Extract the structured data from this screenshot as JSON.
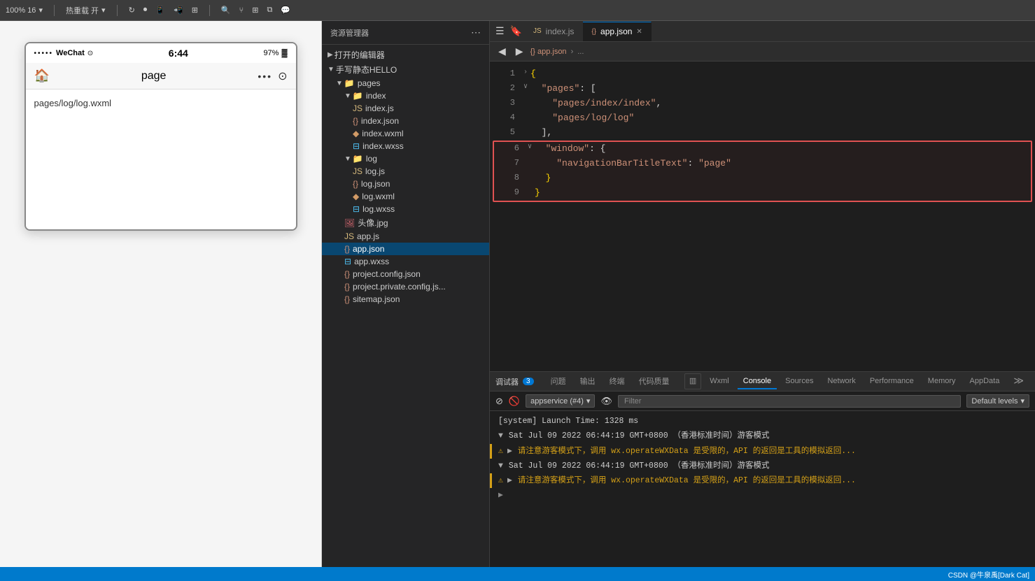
{
  "toolbar": {
    "zoom": "100% 16",
    "hotreload": "热重载 开",
    "icons": [
      "refresh",
      "record",
      "phone",
      "tablet",
      "split",
      "search",
      "branch",
      "grid",
      "copy",
      "wechat"
    ],
    "tabs": [
      {
        "label": "index.js",
        "icon": "js"
      },
      {
        "label": "app.json",
        "icon": "json",
        "active": true,
        "closeable": true
      }
    ]
  },
  "file_explorer": {
    "title": "资源管理器",
    "sections": [
      {
        "label": "打开的编辑器",
        "expanded": false
      },
      {
        "label": "手写静态HELLO",
        "expanded": true
      }
    ],
    "tree": [
      {
        "name": "pages",
        "type": "folder",
        "indent": 2,
        "expanded": true
      },
      {
        "name": "index",
        "type": "folder",
        "indent": 3,
        "expanded": true
      },
      {
        "name": "index.js",
        "type": "js",
        "indent": 4
      },
      {
        "name": "index.json",
        "type": "json",
        "indent": 4
      },
      {
        "name": "index.wxml",
        "type": "wxml",
        "indent": 4
      },
      {
        "name": "index.wxss",
        "type": "wxss",
        "indent": 4
      },
      {
        "name": "log",
        "type": "folder",
        "indent": 3,
        "expanded": true
      },
      {
        "name": "log.js",
        "type": "js",
        "indent": 4
      },
      {
        "name": "log.json",
        "type": "json",
        "indent": 4
      },
      {
        "name": "log.wxml",
        "type": "wxml",
        "indent": 4
      },
      {
        "name": "log.wxss",
        "type": "wxss",
        "indent": 4
      },
      {
        "name": "头像.jpg",
        "type": "jpg",
        "indent": 3
      },
      {
        "name": "app.js",
        "type": "js",
        "indent": 3
      },
      {
        "name": "app.json",
        "type": "json",
        "indent": 3,
        "selected": true
      },
      {
        "name": "app.wxss",
        "type": "wxss",
        "indent": 3
      },
      {
        "name": "project.config.json",
        "type": "json",
        "indent": 3
      },
      {
        "name": "project.private.config.js...",
        "type": "json",
        "indent": 3
      },
      {
        "name": "sitemap.json",
        "type": "json",
        "indent": 3
      }
    ]
  },
  "editor": {
    "breadcrumb": [
      "app.json",
      "..."
    ],
    "nav_back": "◀",
    "nav_forward": "▶",
    "lines": [
      {
        "num": 1,
        "tokens": [
          {
            "t": "{",
            "c": "c-brace"
          }
        ]
      },
      {
        "num": 2,
        "tokens": [
          {
            "t": "  \"pages\": [",
            "c": "c-key"
          }
        ],
        "fold": true
      },
      {
        "num": 3,
        "tokens": [
          {
            "t": "    \"pages/index/index\",",
            "c": "c-string"
          }
        ]
      },
      {
        "num": 4,
        "tokens": [
          {
            "t": "    \"pages/log/log\"",
            "c": "c-string"
          }
        ]
      },
      {
        "num": 5,
        "tokens": [
          {
            "t": "  ],",
            "c": "c-punct"
          }
        ]
      },
      {
        "num": 6,
        "tokens": [
          {
            "t": "  \"window\": {",
            "c": "c-key"
          }
        ],
        "fold": true,
        "highlight_start": true
      },
      {
        "num": 7,
        "tokens": [
          {
            "t": "    \"navigationBarTitleText\": \"page\"",
            "c": "c-key"
          }
        ],
        "highlight": true
      },
      {
        "num": 8,
        "tokens": [
          {
            "t": "  }",
            "c": "c-brace"
          }
        ],
        "highlight": true
      },
      {
        "num": 9,
        "tokens": [
          {
            "t": "}",
            "c": "c-brace"
          }
        ],
        "highlight_end": true
      }
    ]
  },
  "devtools": {
    "tabs_label": "调试器",
    "badge": "3",
    "tabs": [
      {
        "label": "Wxml",
        "active": false
      },
      {
        "label": "Console",
        "active": true
      },
      {
        "label": "Sources",
        "active": false
      },
      {
        "label": "Network",
        "active": false
      },
      {
        "label": "Performance",
        "active": false
      },
      {
        "label": "Memory",
        "active": false
      },
      {
        "label": "AppData",
        "active": false
      }
    ],
    "other_tabs": [
      "问题",
      "输出",
      "终端",
      "代码质量"
    ],
    "console": {
      "context": "appservice (#4)",
      "filter_placeholder": "Filter",
      "levels": "Default levels",
      "lines": [
        {
          "type": "system",
          "text": "[system] Launch Time: 1328 ms"
        },
        {
          "type": "group",
          "text": "▼ Sat Jul 09 2022 06:44:19 GMT+0800 （香港标准时间）游客模式"
        },
        {
          "type": "warn",
          "text": "▶ 请注意游客模式下，调用 wx.operateWXData 是受限的，API 的返回是工具的模拟返回..."
        },
        {
          "type": "group",
          "text": "▼ Sat Jul 09 2022 06:44:19 GMT+0800 （香港标准时间）游客模式"
        },
        {
          "type": "warn",
          "text": "▶ 请注意游客模式下，调用 wx.operateWXData 是受限的，API 的返回是工具的模拟返回..."
        },
        {
          "type": "arrow",
          "text": "▶"
        }
      ]
    }
  },
  "phone": {
    "dots": "•••••",
    "carrier": "WeChat",
    "signal": "⊙",
    "time": "6:44",
    "battery": "97%",
    "battery_icon": "🔋",
    "nav_home": "🏠",
    "nav_title": "page",
    "nav_dots": "•••",
    "nav_circle": "⊙",
    "content_text": "pages/log/log.wxml"
  },
  "status_bar": {
    "text": "CSDN @牛泉禹[Dark Cat]"
  }
}
